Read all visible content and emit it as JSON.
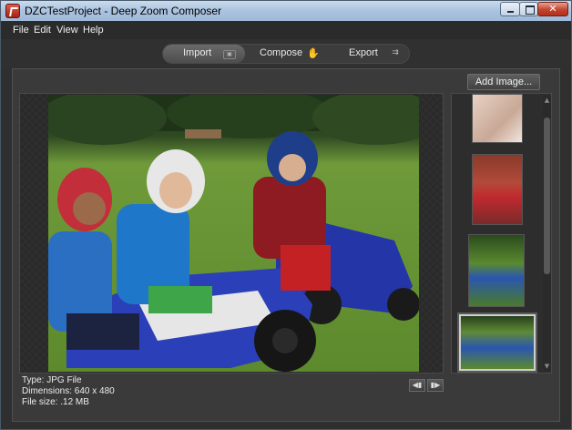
{
  "window": {
    "title": "DZCTestProject - Deep Zoom Composer"
  },
  "menu": [
    "File",
    "Edit",
    "View",
    "Help"
  ],
  "modes": [
    {
      "label": "Import",
      "icon": "import-icon",
      "active": true
    },
    {
      "label": "Compose",
      "icon": "compose-hand-icon",
      "active": false
    },
    {
      "label": "Export",
      "icon": "export-icon",
      "active": false
    }
  ],
  "add_image_label": "Add Image...",
  "file_info": {
    "type": "Type: JPG File",
    "dimensions": "Dimensions: 640 x 480",
    "size": "File size: .12 MB"
  },
  "colors": {
    "app_bg": "#2f2f2f",
    "panel_bg": "#3a3a3a",
    "titlebar": "#aac3df",
    "close": "#c5432d"
  }
}
